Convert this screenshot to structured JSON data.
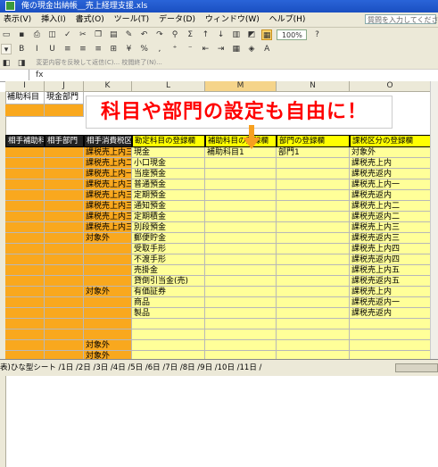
{
  "window": {
    "title": "俺の現金出納帳__売上経理支援.xls"
  },
  "menu": {
    "items": [
      "表示(V)",
      "挿入(I)",
      "書式(O)",
      "ツール(T)",
      "データ(D)",
      "ウィンドウ(W)",
      "ヘルプ(H)"
    ],
    "help_placeholder": "質問を入力してください"
  },
  "toolbar": {
    "zoom": "100%"
  },
  "toolbar3": {
    "text": "変更内容を反映して返信(C)...  校閲終了(N)..."
  },
  "formula": {
    "fx": "fx"
  },
  "columns": [
    "I",
    "J",
    "K",
    "L",
    "M",
    "N",
    "O"
  ],
  "top_row": {
    "i": "補助科目",
    "j": "現金部門"
  },
  "banner": {
    "text": "科目や部門の設定も自由に！"
  },
  "headers": {
    "i": "相手補助科目",
    "j": "相手部門",
    "k": "相手消費税区分",
    "l": "勘定科目の登録欄",
    "m": "補助科目の登録欄",
    "n": "部門の登録欄",
    "o": "課税区分の登録欄"
  },
  "col_k": [
    "課税売上内三",
    "課税売上内二",
    "課税売上内一",
    "課税売上内三",
    "課税売上内三",
    "課税売上内三",
    "課税売上内三",
    "課税売上内三",
    "対象外",
    "",
    "",
    "",
    "",
    "対象外",
    "",
    "",
    "",
    "",
    "対象外",
    "対象外"
  ],
  "col_l": [
    "現金",
    "小口現金",
    "当座預金",
    "普通預金",
    "定期預金",
    "通知預金",
    "定期積金",
    "別段預金",
    "郵便貯金",
    "受取手形",
    "不渡手形",
    "売掛金",
    "貸倒引当金(売)",
    "有価証券",
    "商品",
    "製品"
  ],
  "col_m": [
    "補助科目1"
  ],
  "col_n": [
    "部門1"
  ],
  "col_o": [
    "対象外",
    "課税売上内",
    "課税売返内",
    "課税売上内一",
    "課税売返内",
    "課税売上内二",
    "課税売返内二",
    "課税売上内三",
    "課税売返内三",
    "課税売上内四",
    "課税売返内四",
    "課税売上内五",
    "課税売返内五",
    "課税売上内",
    "課税売返内一",
    "課税売返内"
  ],
  "sheet_tabs": {
    "text": "表)ひな型シート /1日 /2日 /3日 /4日 /5日 /6日 /7日 /8日 /9日 /10日 /11日 /"
  }
}
